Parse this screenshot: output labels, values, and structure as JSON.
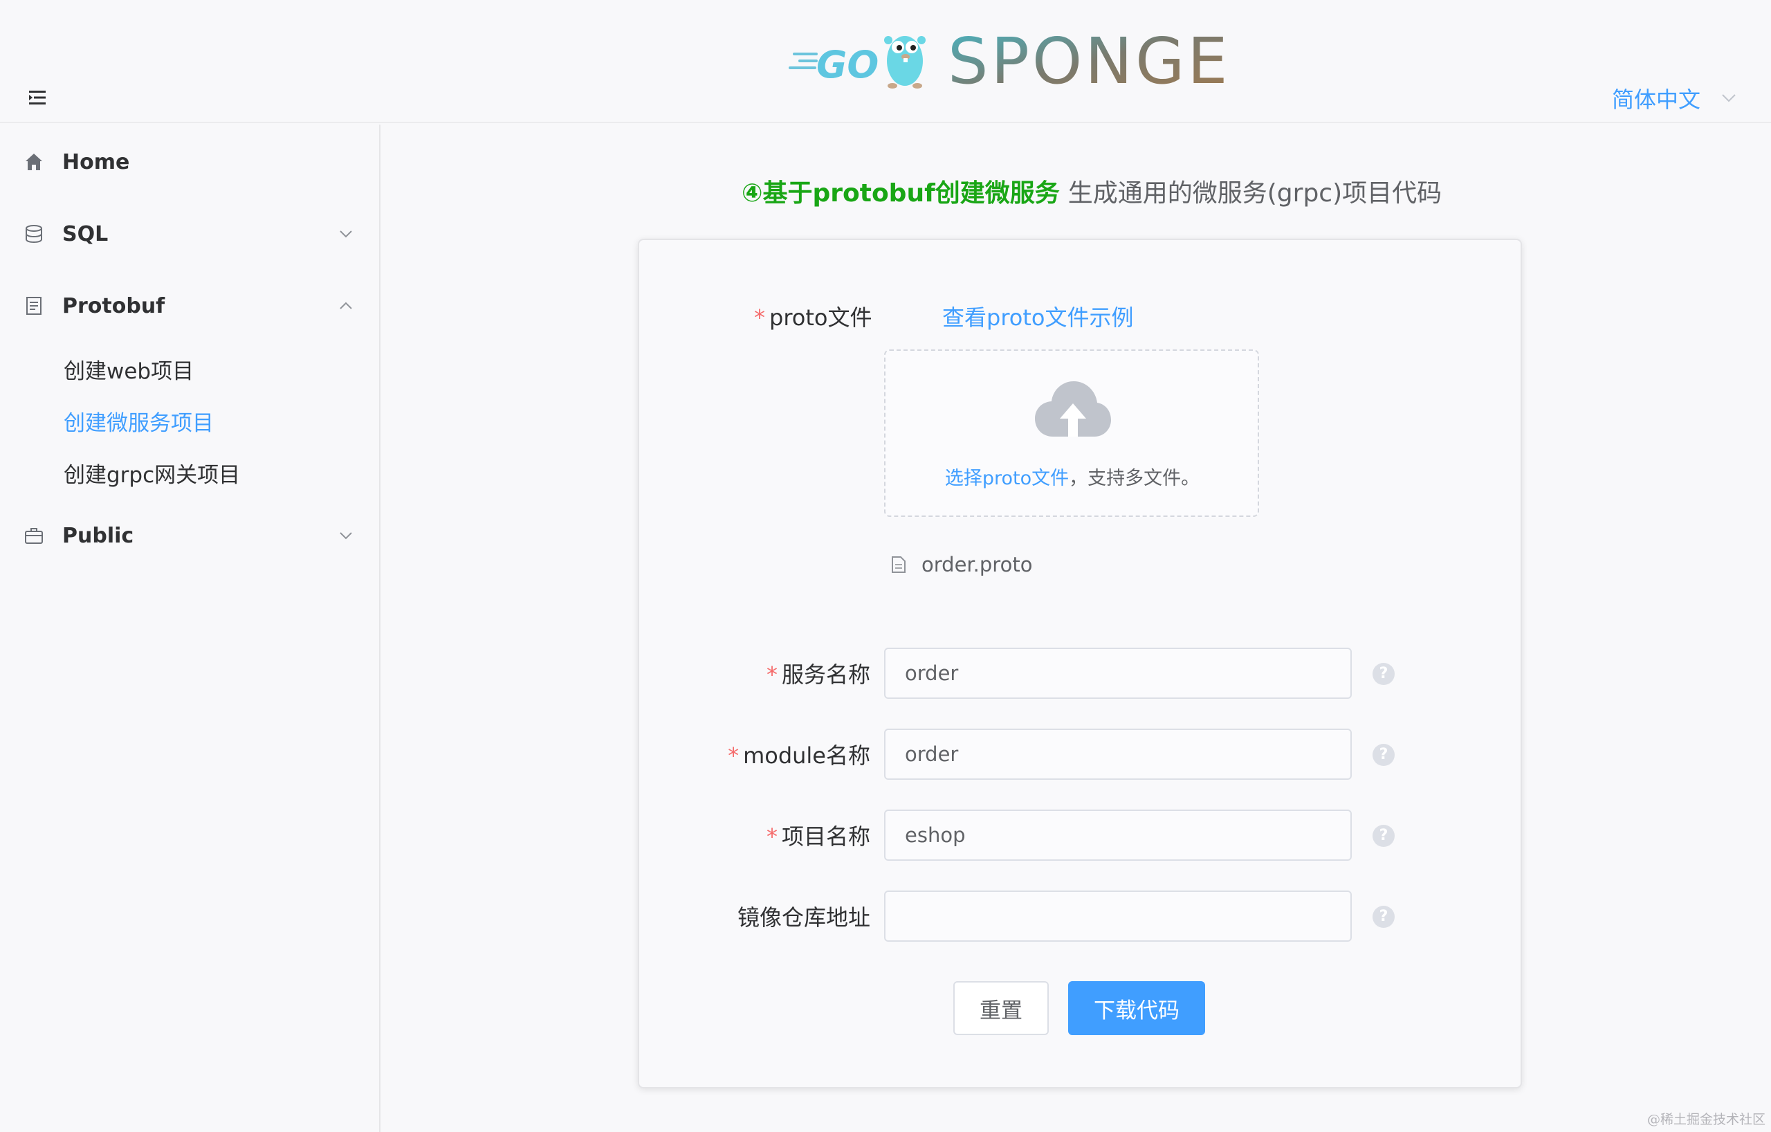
{
  "header": {
    "logo_text": "SPONGE",
    "logo_go_text": "GO",
    "language": "简体中文"
  },
  "sidebar": {
    "items": [
      {
        "label": "Home",
        "icon": "home-icon"
      },
      {
        "label": "SQL",
        "icon": "database-icon",
        "expanded": false
      },
      {
        "label": "Protobuf",
        "icon": "document-icon",
        "expanded": true,
        "children": [
          {
            "label": "创建web项目",
            "active": false
          },
          {
            "label": "创建微服务项目",
            "active": true
          },
          {
            "label": "创建grpc网关项目",
            "active": false
          }
        ]
      },
      {
        "label": "Public",
        "icon": "briefcase-icon",
        "expanded": false
      }
    ]
  },
  "main": {
    "heading_highlight": "④基于protobuf创建微服务",
    "heading_rest": "生成通用的微服务(grpc)项目代码"
  },
  "form": {
    "proto_label": "proto文件",
    "proto_example_link": "查看proto文件示例",
    "upload_hint_link": "选择proto文件",
    "upload_hint_rest": "，支持多文件。",
    "uploaded_file": "order.proto",
    "fields": [
      {
        "label": "服务名称",
        "required": true,
        "value": "order"
      },
      {
        "label": "module名称",
        "required": true,
        "value": "order"
      },
      {
        "label": "项目名称",
        "required": true,
        "value": "eshop"
      },
      {
        "label": "镜像仓库地址",
        "required": false,
        "value": ""
      }
    ],
    "required_mark": "*",
    "help_glyph": "?",
    "reset_label": "重置",
    "download_label": "下载代码"
  },
  "watermark": "@稀土掘金技术社区",
  "colors": {
    "accent": "#409eff",
    "heading_green": "#19a615",
    "required_red": "#f56c6c"
  }
}
